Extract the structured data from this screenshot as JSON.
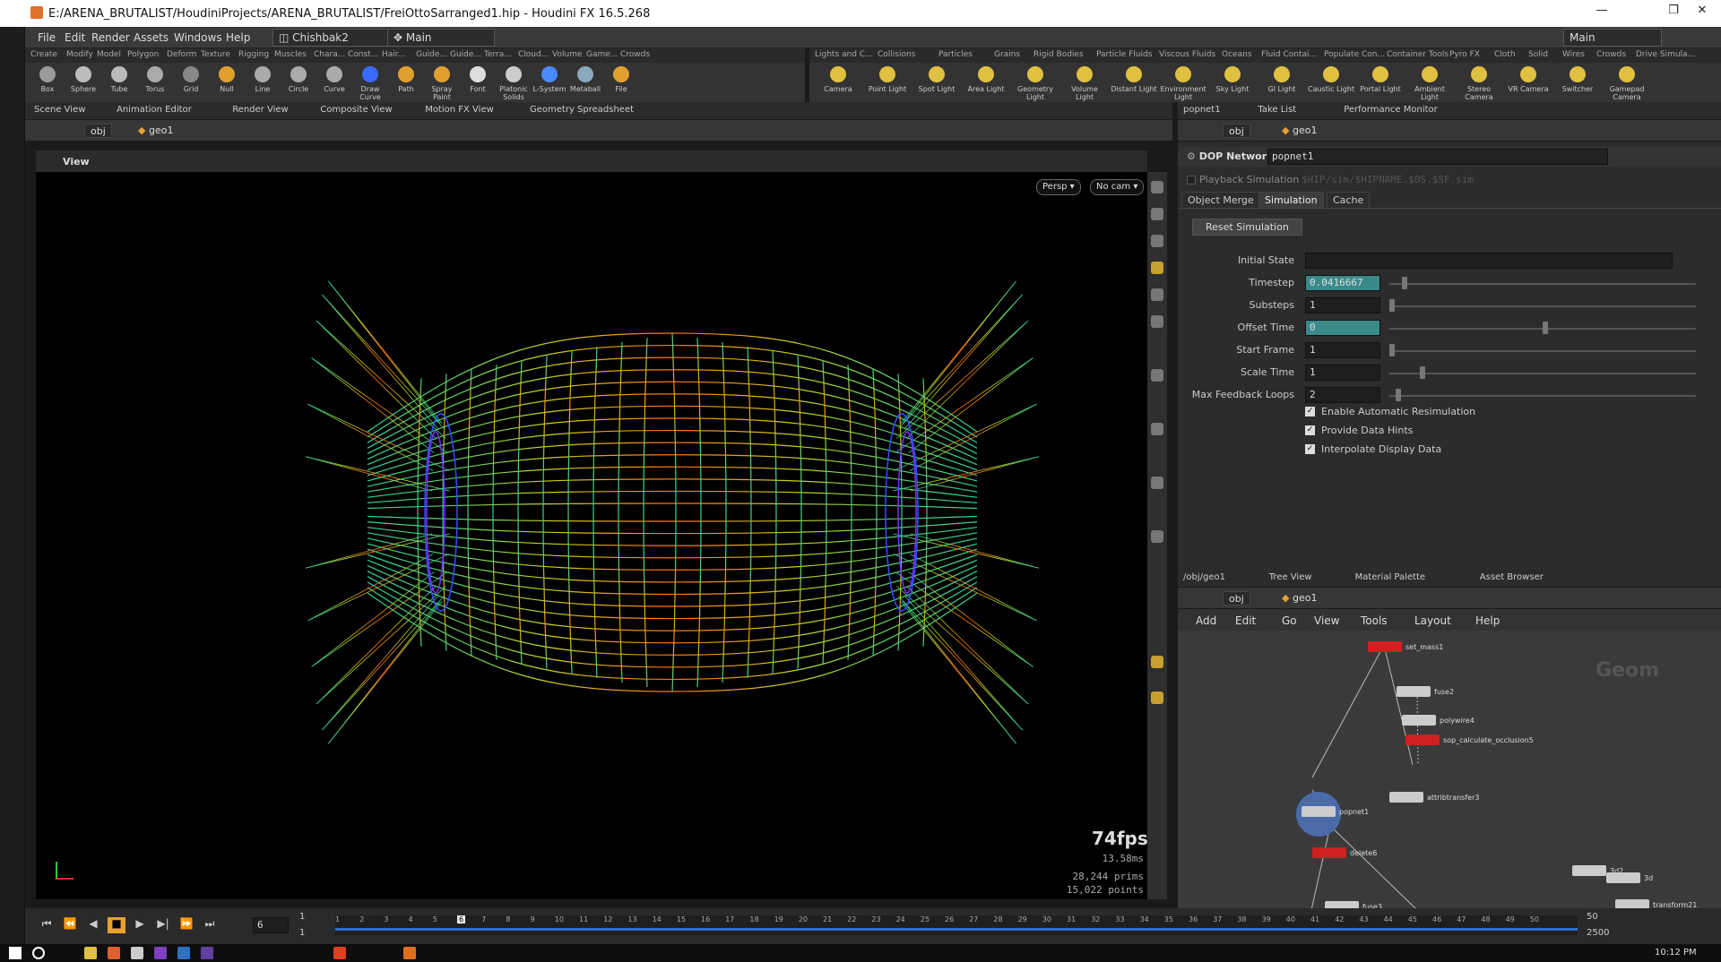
{
  "window": {
    "title": "E:/ARENA_BRUTALIST/HoudiniProjects/ARENA_BRUTALIST/FreiOttoSarranged1.hip - Houdini FX 16.5.268",
    "minimize": "—",
    "maximize": "❐",
    "close": "✕"
  },
  "menu": [
    "File",
    "Edit",
    "Render",
    "Assets",
    "Windows",
    "Help"
  ],
  "desktop": "Chishbak2",
  "workspace": "Main",
  "workspace_right": "Main",
  "shelf_tabs_left": [
    "Create",
    "Modify",
    "Model",
    "Polygon",
    "Deform",
    "Texture",
    "Rigging",
    "Muscles",
    "Chara...",
    "Const...",
    "Hair...",
    "Guide...",
    "Guide...",
    "Terra...",
    "Cloud...",
    "Volume",
    "Game...",
    "Crowds"
  ],
  "shelf_tools_left": [
    "Box",
    "Sphere",
    "Tube",
    "Torus",
    "Grid",
    "Null",
    "Line",
    "Circle",
    "Curve",
    "Draw Curve",
    "Path",
    "Spray Paint",
    "Font",
    "Platonic Solids",
    "L-System",
    "Metaball",
    "File"
  ],
  "shelf_tabs_right": [
    "Lights and C...",
    "Collisions",
    "Particles",
    "Grains",
    "Rigid Bodies",
    "Particle Fluids",
    "Viscous Fluids",
    "Oceans",
    "Fluid Contai...",
    "Populate Con...",
    "Container Tools",
    "Pyro FX",
    "Cloth",
    "Solid",
    "Wires",
    "Crowds",
    "Drive Simula..."
  ],
  "shelf_tools_right": [
    "Camera",
    "Point Light",
    "Spot Light",
    "Area Light",
    "Geometry Light",
    "Volume Light",
    "Distant Light",
    "Environment Light",
    "Sky Light",
    "GI Light",
    "Caustic Light",
    "Portal Light",
    "Ambient Light",
    "Stereo Camera",
    "VR Camera",
    "Switcher",
    "Gamepad Camera"
  ],
  "left_pane_tabs": [
    "Scene View",
    "Animation Editor",
    "Render View",
    "Composite View",
    "Motion FX View",
    "Geometry Spreadsheet"
  ],
  "path": {
    "obj": "obj",
    "geo": "geo1"
  },
  "viewport": {
    "label": "View",
    "persp": "Persp ▾",
    "cam": "No cam ▾",
    "fps": "74fps",
    "ms": "13.58ms",
    "prims_count": "28,244",
    "prims_label": "prims",
    "points_count": "15,022",
    "points_label": "points"
  },
  "right_pane_tabs": [
    "popnet1",
    "Take List",
    "Performance Monitor"
  ],
  "dop": {
    "type_label": "DOP Network",
    "name": "popnet1",
    "playback_label": "Playback Simulation",
    "playback_path": "$HIP/sim/$HIPNAME.$OS.$SF.sim",
    "tabs": [
      "Object Merge",
      "Simulation",
      "Cache"
    ],
    "reset": "Reset Simulation",
    "params": [
      {
        "label": "Initial State",
        "value": ""
      },
      {
        "label": "Timestep",
        "value": "0.0416667"
      },
      {
        "label": "Substeps",
        "value": "1"
      },
      {
        "label": "Offset Time",
        "value": "0"
      },
      {
        "label": "Start Frame",
        "value": "1"
      },
      {
        "label": "Scale Time",
        "value": "1"
      },
      {
        "label": "Max Feedback Loops",
        "value": "2"
      }
    ],
    "checks": [
      "Enable Automatic Resimulation",
      "Provide Data Hints",
      "Interpolate Display Data"
    ]
  },
  "net_tabs": [
    "/obj/geo1",
    "Tree View",
    "Material Palette",
    "Asset Browser"
  ],
  "net_menu": [
    "Add",
    "Edit",
    "Go",
    "View",
    "Tools",
    "Layout",
    "Help"
  ],
  "net_watermark": "Geom",
  "nodes": [
    "set_mass1",
    "fuse2",
    "polywire4",
    "sop_calculate_occlusion5",
    "attribtransfer3",
    "popnet1",
    "delete6",
    "fuse3",
    "3d2",
    "3d",
    "transform21"
  ],
  "timeline": {
    "frame": "6",
    "start": "1",
    "start2": "1",
    "end": "50",
    "end2": "2500",
    "ticks": [
      "1",
      "2",
      "3",
      "4",
      "5",
      "6",
      "7",
      "8",
      "9",
      "10",
      "11",
      "12",
      "13",
      "14",
      "15",
      "16",
      "17",
      "18",
      "19",
      "20",
      "21",
      "22",
      "23",
      "24",
      "25",
      "26",
      "27",
      "28",
      "29",
      "30",
      "31",
      "32",
      "33",
      "34",
      "35",
      "36",
      "37",
      "38",
      "39",
      "40",
      "41",
      "42",
      "43",
      "44",
      "45",
      "46",
      "47",
      "48",
      "49",
      "50"
    ]
  },
  "taskbar": {
    "clock": "10:12 PM"
  }
}
